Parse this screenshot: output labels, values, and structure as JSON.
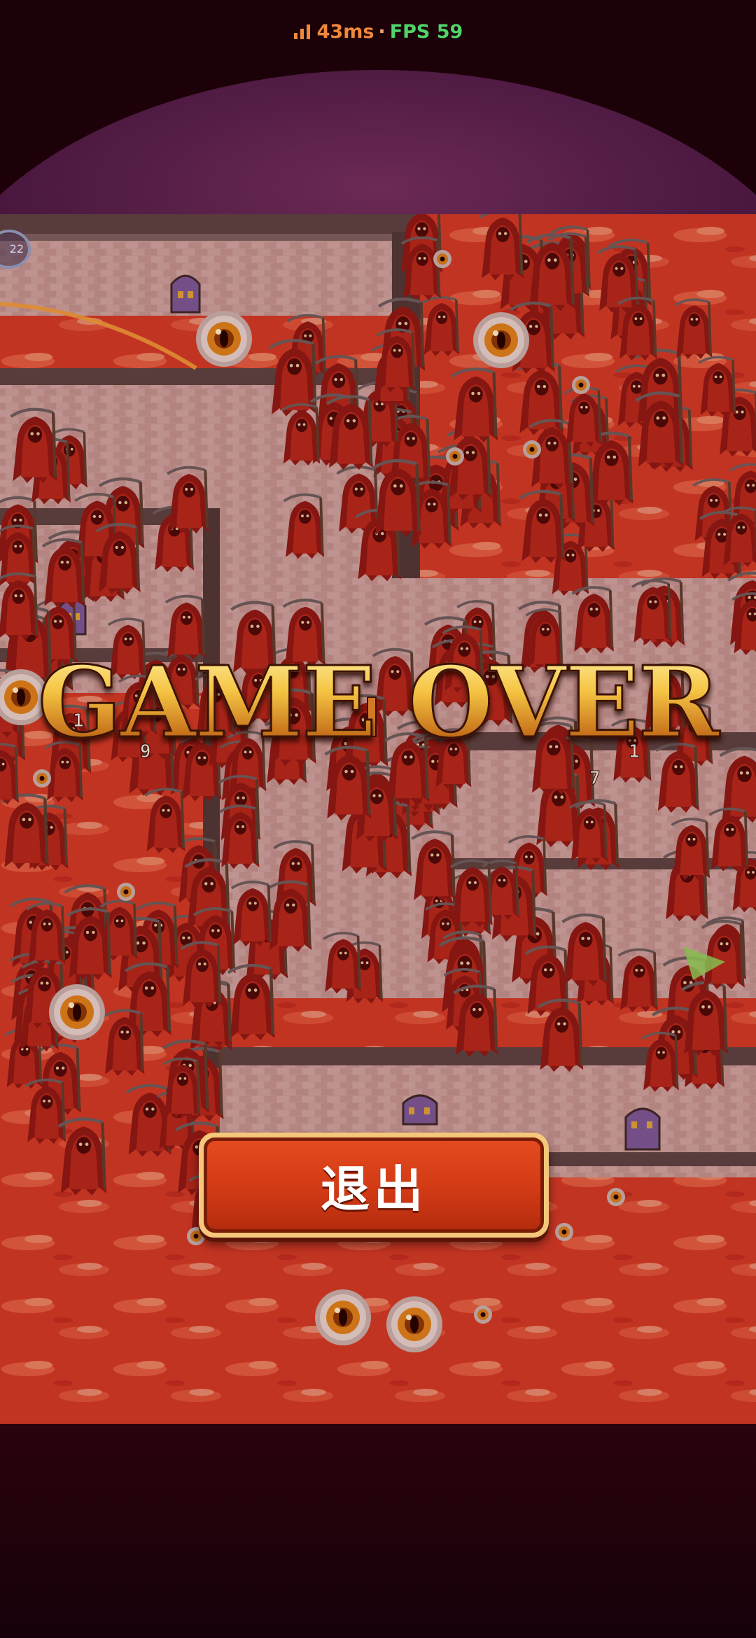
{
  "status_bar": {
    "latency": "43ms",
    "separator": "·",
    "fps": "FPS 59"
  },
  "hud": {
    "level_badge": "22"
  },
  "overlay": {
    "title": "GAME OVER",
    "exit_button_label": "退出"
  },
  "floating_numbers": [
    "1",
    "9",
    "1",
    "7"
  ],
  "icons": [
    "signal-bars-icon",
    "arrow-cursor-icon"
  ],
  "colors": {
    "latency": "#f0883a",
    "fps": "#4fd36a",
    "title_gold": "#f5c443",
    "button_red": "#d23a15",
    "button_border": "#f4c77a",
    "sky_red": "#c9372a"
  }
}
